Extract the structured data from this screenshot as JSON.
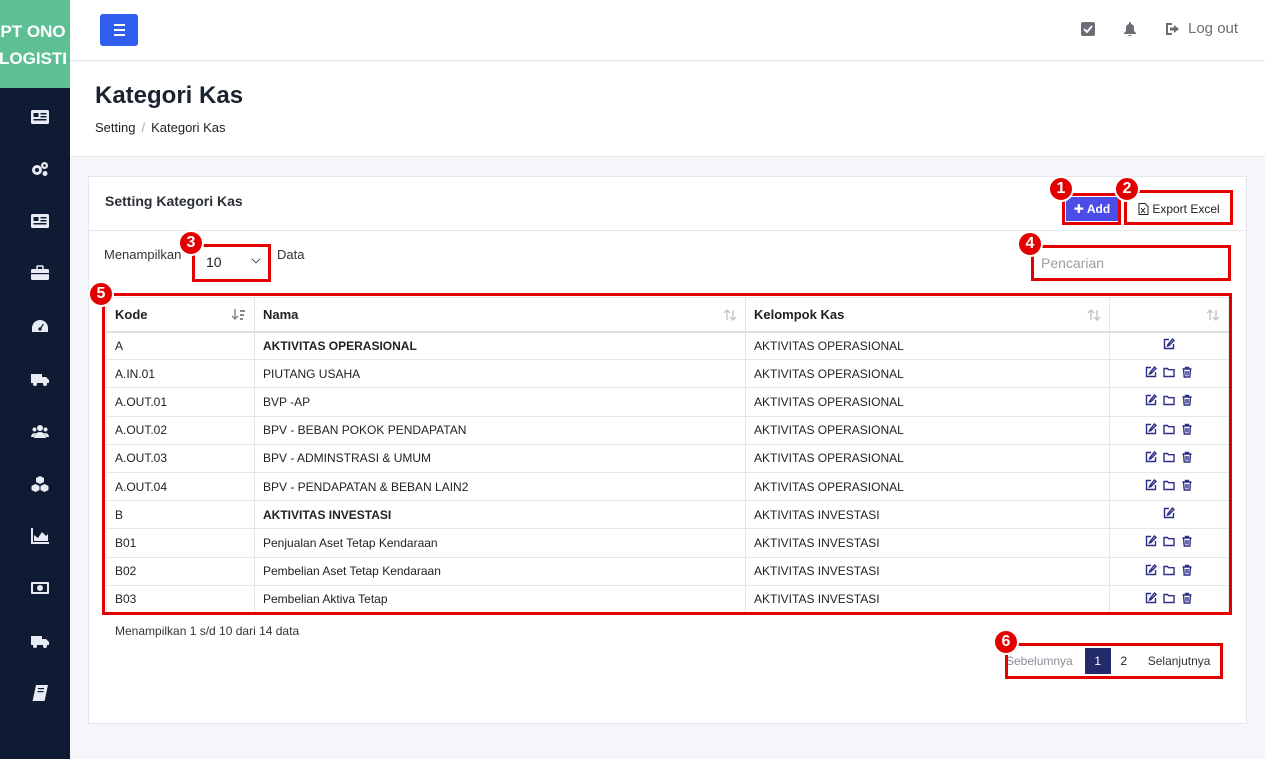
{
  "brand": {
    "line1": "PT ONO",
    "line2": "LOGISTI"
  },
  "sidebar": {
    "icons": [
      "id-card-icon",
      "cogs-icon",
      "id-card-icon",
      "briefcase-icon",
      "dashboard-icon",
      "truck-icon",
      "users-icon",
      "cubes-icon",
      "chart-icon",
      "money-icon",
      "truck-icon",
      "book-icon"
    ]
  },
  "topbar": {
    "logout_label": "Log out"
  },
  "page": {
    "title": "Kategori Kas",
    "breadcrumb": [
      "Setting",
      "/",
      "Kategori Kas"
    ]
  },
  "card": {
    "title": "Setting Kategori Kas",
    "add_label": "Add",
    "export_label": "Export Excel",
    "show_label": "Menampilkan",
    "page_size": "10",
    "data_label": "Data",
    "search_placeholder": "Pencarian"
  },
  "table": {
    "headers": [
      "Kode",
      "Nama",
      "Kelompok Kas",
      ""
    ],
    "rows": [
      {
        "kode": "A",
        "nama": "AKTIVITAS OPERASIONAL",
        "kelompok": "AKTIVITAS OPERASIONAL",
        "bold": true
      },
      {
        "kode": "A.IN.01",
        "nama": "PIUTANG USAHA",
        "kelompok": "AKTIVITAS OPERASIONAL",
        "bold": false
      },
      {
        "kode": "A.OUT.01",
        "nama": "BVP -AP",
        "kelompok": "AKTIVITAS OPERASIONAL",
        "bold": false
      },
      {
        "kode": "A.OUT.02",
        "nama": "BPV - BEBAN POKOK PENDAPATAN",
        "kelompok": "AKTIVITAS OPERASIONAL",
        "bold": false
      },
      {
        "kode": "A.OUT.03",
        "nama": "BPV - ADMINSTRASI & UMUM",
        "kelompok": "AKTIVITAS OPERASIONAL",
        "bold": false
      },
      {
        "kode": "A.OUT.04",
        "nama": "BPV - PENDAPATAN & BEBAN LAIN2",
        "kelompok": "AKTIVITAS OPERASIONAL",
        "bold": false
      },
      {
        "kode": "B",
        "nama": "AKTIVITAS INVESTASI",
        "kelompok": "AKTIVITAS INVESTASI",
        "bold": true
      },
      {
        "kode": "B01",
        "nama": "Penjualan Aset Tetap Kendaraan",
        "kelompok": "AKTIVITAS INVESTASI",
        "bold": false
      },
      {
        "kode": "B02",
        "nama": "Pembelian Aset Tetap Kendaraan",
        "kelompok": "AKTIVITAS INVESTASI",
        "bold": false
      },
      {
        "kode": "B03",
        "nama": "Pembelian Aktiva Tetap",
        "kelompok": "AKTIVITAS INVESTASI",
        "bold": false
      }
    ]
  },
  "info": "Menampilkan 1 s/d 10 dari 14 data",
  "pagination": {
    "prev": "Sebelumnya",
    "pages": [
      "1",
      "2"
    ],
    "active": "1",
    "next": "Selanjutnya"
  },
  "annotations": [
    "1",
    "2",
    "3",
    "4",
    "5",
    "6"
  ],
  "colors": {
    "brand": "#5fbf94",
    "sidebar": "#0f1a33",
    "primary": "#2f5ef0",
    "add": "#4c4de8",
    "annotation": "#e30000",
    "pager_active": "#232a6a"
  }
}
